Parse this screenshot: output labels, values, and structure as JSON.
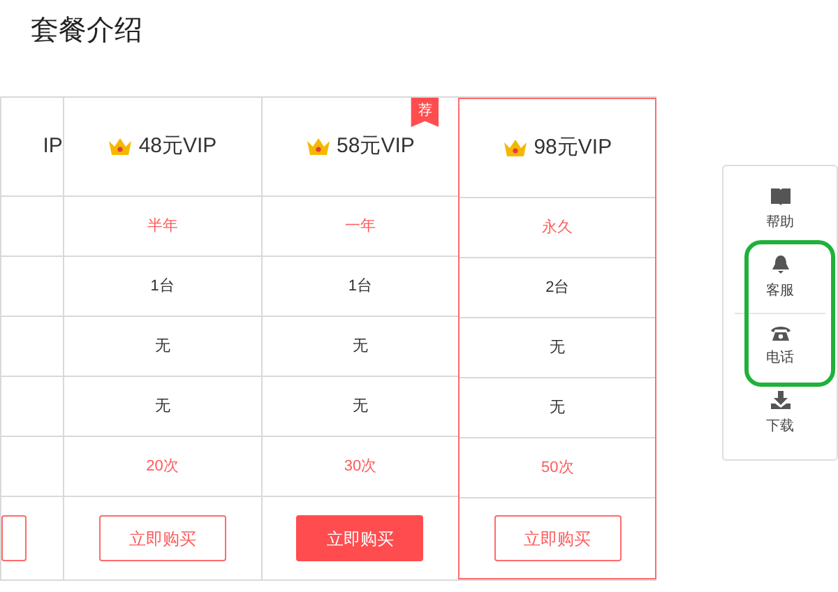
{
  "title": "套餐介绍",
  "plans": [
    {
      "name": "IP",
      "partial": true,
      "selected": false,
      "button": {
        "filled": false
      }
    },
    {
      "name": "48元VIP",
      "partial": false,
      "selected": false,
      "cells": [
        {
          "text": "半年",
          "accent": true
        },
        {
          "text": "1台",
          "accent": false
        },
        {
          "text": "无",
          "accent": false
        },
        {
          "text": "无",
          "accent": false
        },
        {
          "text": "20次",
          "accent": true
        }
      ],
      "button": {
        "label": "立即购买",
        "filled": false
      }
    },
    {
      "name": "58元VIP",
      "partial": false,
      "selected": false,
      "badge": "荐",
      "cells": [
        {
          "text": "一年",
          "accent": true
        },
        {
          "text": "1台",
          "accent": false
        },
        {
          "text": "无",
          "accent": false
        },
        {
          "text": "无",
          "accent": false
        },
        {
          "text": "30次",
          "accent": true
        }
      ],
      "button": {
        "label": "立即购买",
        "filled": true
      }
    },
    {
      "name": "98元VIP",
      "partial": false,
      "selected": true,
      "cells": [
        {
          "text": "永久",
          "accent": true
        },
        {
          "text": "2台",
          "accent": false
        },
        {
          "text": "无",
          "accent": false
        },
        {
          "text": "无",
          "accent": false
        },
        {
          "text": "50次",
          "accent": true
        }
      ],
      "button": {
        "label": "立即购买",
        "filled": false
      }
    }
  ],
  "side_panel": [
    {
      "kind": "book",
      "label": "帮助"
    },
    {
      "kind": "bell",
      "label": "客服"
    },
    {
      "kind": "phone",
      "label": "电话"
    },
    {
      "kind": "download",
      "label": "下载"
    }
  ]
}
